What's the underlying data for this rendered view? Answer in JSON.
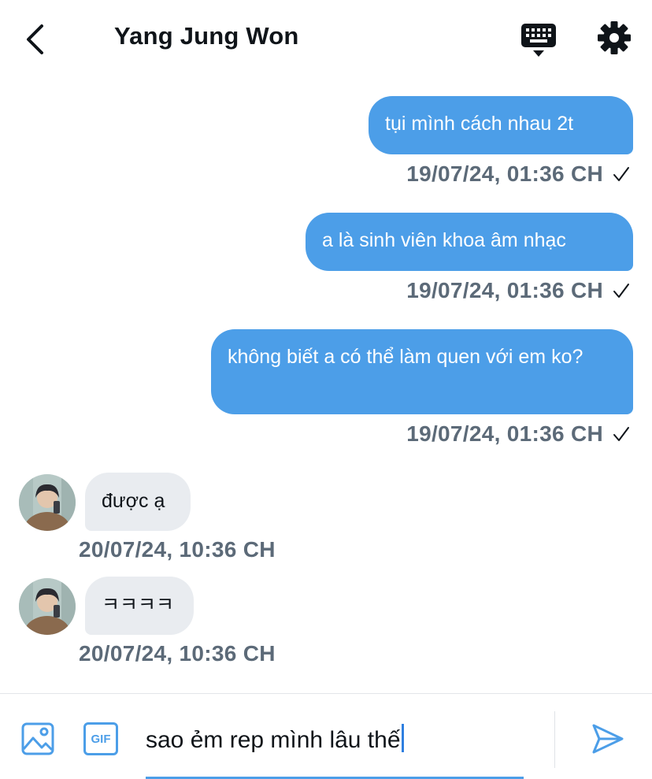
{
  "header": {
    "title": "Yang Jung Won",
    "icons": [
      "back-arrow-icon",
      "keyboard-icon",
      "gear-icon"
    ]
  },
  "messages": [
    {
      "direction": "outgoing",
      "text": "tụi mình cách nhau 2t",
      "timestamp": "19/07/24, 01:36 CH",
      "status_icon": "checkmark-icon"
    },
    {
      "direction": "outgoing",
      "text": "a là sinh viên khoa âm nhạc",
      "timestamp": "19/07/24, 01:36 CH",
      "status_icon": "checkmark-icon"
    },
    {
      "direction": "outgoing",
      "text": "không biết a có thể làm quen với em ko?",
      "timestamp": "19/07/24, 01:36 CH",
      "status_icon": "checkmark-icon"
    },
    {
      "direction": "incoming",
      "text": "được ạ",
      "timestamp": "20/07/24, 10:36 CH"
    },
    {
      "direction": "incoming",
      "text": "ㅋㅋㅋㅋ",
      "timestamp": "20/07/24, 10:36 CH"
    }
  ],
  "composer": {
    "value": "sao ẻm rep mình lâu thế",
    "gif_label": "GIF",
    "icons": [
      "image-icon",
      "gif-icon",
      "send-icon"
    ]
  },
  "colors": {
    "accent": "#4c9ee8",
    "incoming_bubble": "#e9ecf0",
    "timestamp": "#5c6a78"
  }
}
